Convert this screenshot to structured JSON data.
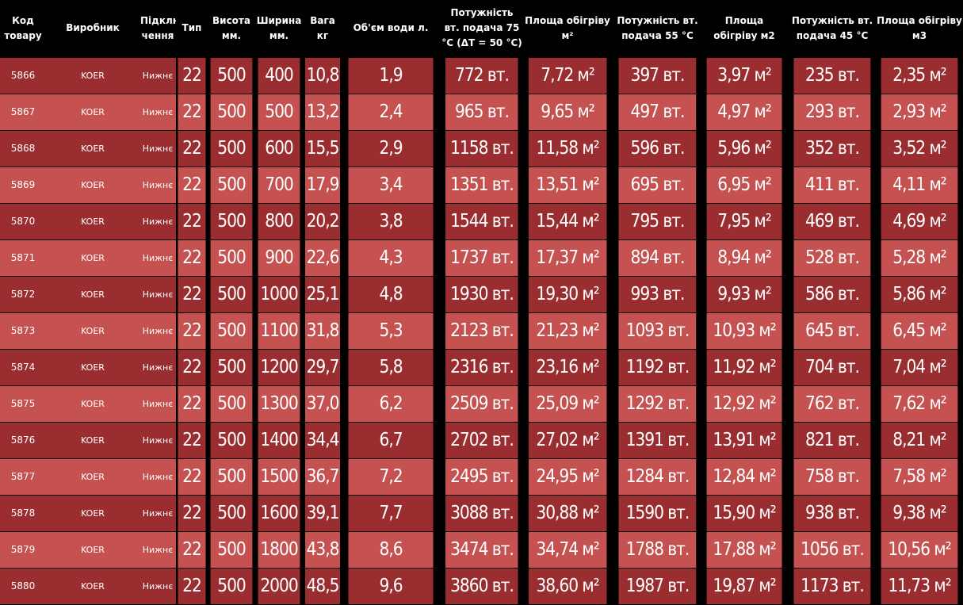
{
  "headers": {
    "code": "Код товару",
    "maker": "Виробник",
    "conn": "Підклю чення",
    "type": "Тип",
    "height": "Висота мм.",
    "width": "Ширина мм.",
    "weight": "Вага кг",
    "volume": "Об'єм води л.",
    "p75": "Потужність вт. подача 75 °C (ΔT = 50 °C)",
    "a75": "Площа обігріву м²",
    "p55": "Потужність вт. подача 55 °C",
    "a55": "Площа обігріву м2",
    "p45": "Потужність вт. подача 45 °C",
    "a45": "Площа обігріву м3"
  },
  "rows": [
    {
      "code": "5866",
      "maker": "KOER",
      "conn": "Нижнє",
      "type": "22",
      "height": "500",
      "width": "400",
      "weight": "10,8",
      "volume": "1,9",
      "p75": "772 вт.",
      "a75": "7,72 м²",
      "p55": "397 вт.",
      "a55": "3,97 м²",
      "p45": "235 вт.",
      "a45": "2,35 м²"
    },
    {
      "code": "5867",
      "maker": "KOER",
      "conn": "Нижнє",
      "type": "22",
      "height": "500",
      "width": "500",
      "weight": "13,2",
      "volume": "2,4",
      "p75": "965 вт.",
      "a75": "9,65 м²",
      "p55": "497 вт.",
      "a55": "4,97 м²",
      "p45": "293 вт.",
      "a45": "2,93 м²"
    },
    {
      "code": "5868",
      "maker": "KOER",
      "conn": "Нижнє",
      "type": "22",
      "height": "500",
      "width": "600",
      "weight": "15,5",
      "volume": "2,9",
      "p75": "1158 вт.",
      "a75": "11,58 м²",
      "p55": "596 вт.",
      "a55": "5,96 м²",
      "p45": "352 вт.",
      "a45": "3,52 м²"
    },
    {
      "code": "5869",
      "maker": "KOER",
      "conn": "Нижнє",
      "type": "22",
      "height": "500",
      "width": "700",
      "weight": "17,9",
      "volume": "3,4",
      "p75": "1351 вт.",
      "a75": "13,51 м²",
      "p55": "695 вт.",
      "a55": "6,95 м²",
      "p45": "411 вт.",
      "a45": "4,11 м²"
    },
    {
      "code": "5870",
      "maker": "KOER",
      "conn": "Нижнє",
      "type": "22",
      "height": "500",
      "width": "800",
      "weight": "20,2",
      "volume": "3,8",
      "p75": "1544 вт.",
      "a75": "15,44 м²",
      "p55": "795 вт.",
      "a55": "7,95 м²",
      "p45": "469 вт.",
      "a45": "4,69 м²"
    },
    {
      "code": "5871",
      "maker": "KOER",
      "conn": "Нижнє",
      "type": "22",
      "height": "500",
      "width": "900",
      "weight": "22,6",
      "volume": "4,3",
      "p75": "1737 вт.",
      "a75": "17,37 м²",
      "p55": "894 вт.",
      "a55": "8,94 м²",
      "p45": "528 вт.",
      "a45": "5,28 м²"
    },
    {
      "code": "5872",
      "maker": "KOER",
      "conn": "Нижнє",
      "type": "22",
      "height": "500",
      "width": "1000",
      "weight": "25,1",
      "volume": "4,8",
      "p75": "1930 вт.",
      "a75": "19,30 м²",
      "p55": "993 вт.",
      "a55": "9,93 м²",
      "p45": "586 вт.",
      "a45": "5,86 м²"
    },
    {
      "code": "5873",
      "maker": "KOER",
      "conn": "Нижнє",
      "type": "22",
      "height": "500",
      "width": "1100",
      "weight": "31,8",
      "volume": "5,3",
      "p75": "2123 вт.",
      "a75": "21,23 м²",
      "p55": "1093 вт.",
      "a55": "10,93 м²",
      "p45": "645 вт.",
      "a45": "6,45 м²"
    },
    {
      "code": "5874",
      "maker": "KOER",
      "conn": "Нижнє",
      "type": "22",
      "height": "500",
      "width": "1200",
      "weight": "29,7",
      "volume": "5,8",
      "p75": "2316 вт.",
      "a75": "23,16 м²",
      "p55": "1192 вт.",
      "a55": "11,92 м²",
      "p45": "704 вт.",
      "a45": "7,04 м²"
    },
    {
      "code": "5875",
      "maker": "KOER",
      "conn": "Нижнє",
      "type": "22",
      "height": "500",
      "width": "1300",
      "weight": "37,0",
      "volume": "6,2",
      "p75": "2509 вт.",
      "a75": "25,09 м²",
      "p55": "1292 вт.",
      "a55": "12,92 м²",
      "p45": "762 вт.",
      "a45": "7,62 м²"
    },
    {
      "code": "5876",
      "maker": "KOER",
      "conn": "Нижнє",
      "type": "22",
      "height": "500",
      "width": "1400",
      "weight": "34,4",
      "volume": "6,7",
      "p75": "2702 вт.",
      "a75": "27,02 м²",
      "p55": "1391 вт.",
      "a55": "13,91 м²",
      "p45": "821 вт.",
      "a45": "8,21 м²"
    },
    {
      "code": "5877",
      "maker": "KOER",
      "conn": "Нижнє",
      "type": "22",
      "height": "500",
      "width": "1500",
      "weight": "36,7",
      "volume": "7,2",
      "p75": "2495 вт.",
      "a75": "24,95 м²",
      "p55": "1284 вт.",
      "a55": "12,84 м²",
      "p45": "758 вт.",
      "a45": "7,58 м²"
    },
    {
      "code": "5878",
      "maker": "KOER",
      "conn": "Нижнє",
      "type": "22",
      "height": "500",
      "width": "1600",
      "weight": "39,1",
      "volume": "7,7",
      "p75": "3088 вт.",
      "a75": "30,88 м²",
      "p55": "1590 вт.",
      "a55": "15,90 м²",
      "p45": "938 вт.",
      "a45": "9,38 м²"
    },
    {
      "code": "5879",
      "maker": "KOER",
      "conn": "Нижнє",
      "type": "22",
      "height": "500",
      "width": "1800",
      "weight": "43,8",
      "volume": "8,6",
      "p75": "3474 вт.",
      "a75": "34,74 м²",
      "p55": "1788 вт.",
      "a55": "17,88 м²",
      "p45": "1056 вт.",
      "a45": "10,56 м²"
    },
    {
      "code": "5880",
      "maker": "KOER",
      "conn": "Нижнє",
      "type": "22",
      "height": "500",
      "width": "2000",
      "weight": "48,5",
      "volume": "9,6",
      "p75": "3860 вт.",
      "a75": "38,60 м²",
      "p55": "1987 вт.",
      "a55": "19,87 м²",
      "p45": "1173 вт.",
      "a45": "11,73 м²"
    }
  ]
}
